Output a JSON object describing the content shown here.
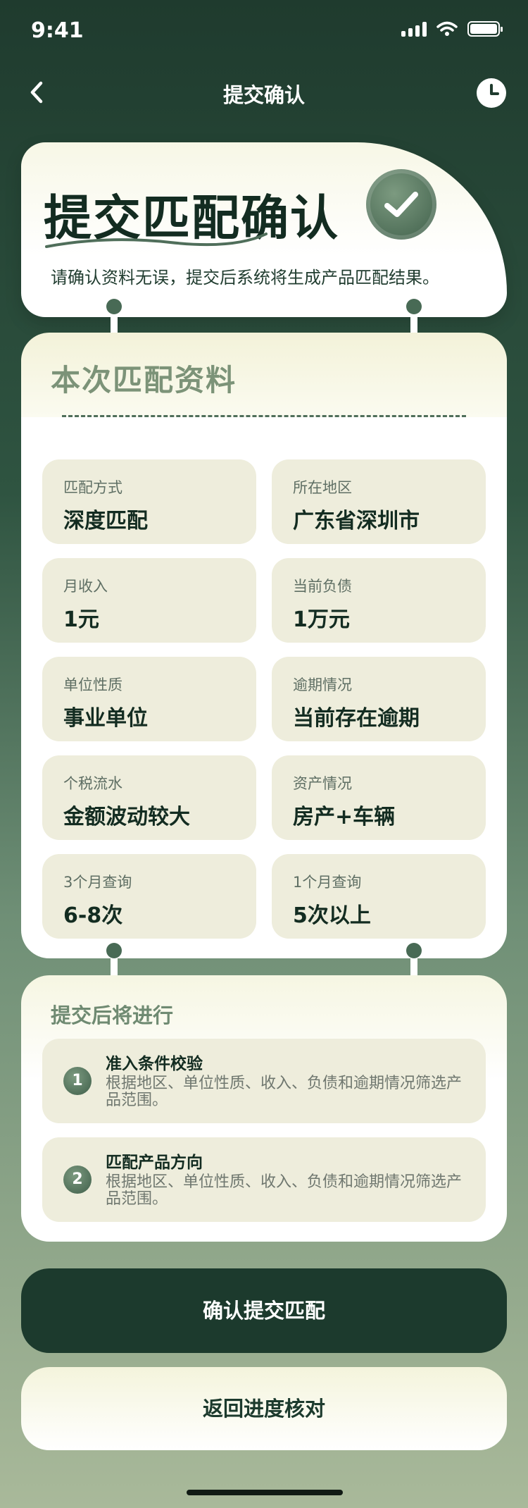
{
  "status_bar": {
    "time": "9:41"
  },
  "nav": {
    "title": "提交确认"
  },
  "hero": {
    "title": "提交匹配确认",
    "description": "请确认资料无误，提交后系统将生成产品匹配结果。"
  },
  "summary": {
    "title": "本次匹配资料",
    "items": [
      {
        "label": "匹配方式",
        "value": "深度匹配"
      },
      {
        "label": "所在地区",
        "value": "广东省深圳市"
      },
      {
        "label": "月收入",
        "value": "1元"
      },
      {
        "label": "当前负债",
        "value": "1万元"
      },
      {
        "label": "单位性质",
        "value": "事业单位"
      },
      {
        "label": "逾期情况",
        "value": "当前存在逾期"
      },
      {
        "label": "个税流水",
        "value": "金额波动较大"
      },
      {
        "label": "资产情况",
        "value": "房产+车辆"
      },
      {
        "label": "3个月查询",
        "value": "6-8次"
      },
      {
        "label": "1个月查询",
        "value": "5次以上"
      }
    ]
  },
  "next_steps": {
    "title": "提交后将进行",
    "items": [
      {
        "num": "1",
        "title": "准入条件校验",
        "desc": "根据地区、单位性质、收入、负债和逾期情况筛选产品范围。"
      },
      {
        "num": "2",
        "title": "匹配产品方向",
        "desc": "根据地区、单位性质、收入、负债和逾期情况筛选产品范围。"
      }
    ]
  },
  "buttons": {
    "confirm": "确认提交匹配",
    "back": "返回进度核对"
  },
  "colors": {
    "primary": "#1c3a2d",
    "accent": "#486a55",
    "cell_bg": "#eeeddc"
  },
  "icons": {
    "back": "chevron-left-icon",
    "history": "clock-icon",
    "check": "check-icon"
  }
}
